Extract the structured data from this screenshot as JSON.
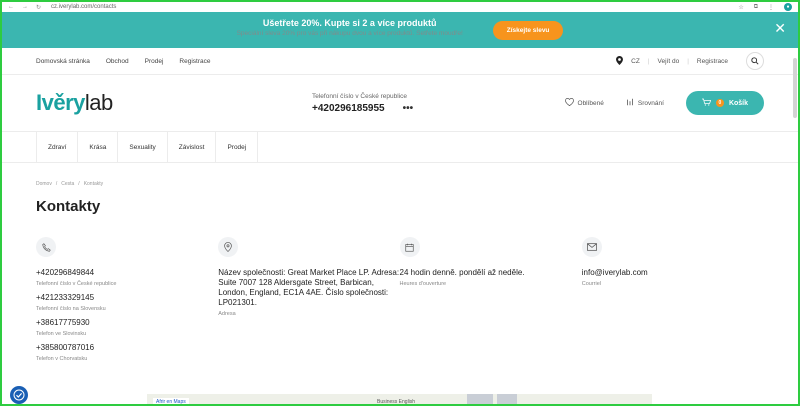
{
  "browser": {
    "url": "cz.iverylab.com/contacts"
  },
  "promo": {
    "title": "Ušetřete 20%. Kupte si 2 a více produktů",
    "subtitle": "Speciální sleva 20% pro vás při nákupu dvou a více produktů. Setřete moudře!",
    "button": "Získejte slevu"
  },
  "topbar": {
    "links": [
      "Domovská stránka",
      "Obchod",
      "Prodej",
      "Registrace"
    ],
    "country": "CZ",
    "login": "Vejít do",
    "register": "Registrace"
  },
  "header": {
    "logo_main": "Ivěry",
    "logo_suffix": "lab",
    "phone_label": "Telefonní číslo v České republice",
    "phone": "+420296185955",
    "more": "•••",
    "favorites": "Oblíbené",
    "compare": "Srovnání",
    "cart": "Košík",
    "cart_count": "0"
  },
  "categories": [
    "Zdraví",
    "Krása",
    "Sexuality",
    "Závislost",
    "Prodej"
  ],
  "breadcrumb": [
    "Domov",
    "Cesta",
    "Kontakty"
  ],
  "page_title": "Kontakty",
  "contacts": {
    "phones": [
      {
        "number": "+420296849844",
        "label": "Telefonní číslo v České republice"
      },
      {
        "number": "+421233329145",
        "label": "Telefonní číslo na Slovensku"
      },
      {
        "number": "+38617775930",
        "label": "Telefon ve Slovinsku"
      },
      {
        "number": "+385800787016",
        "label": "Telefon v Chorvatsku"
      }
    ],
    "address": {
      "value": "Název společnosti: Great Market Place LP. Adresa: Suite 7007 128 Aldersgate Street, Barbican, London, England, EC1A 4AE. Číslo společnosti: LP021301.",
      "label": "Adresa"
    },
    "hours": {
      "value": "24 hodin denně. pondělí až neděle.",
      "label": "Heures d'ouverture"
    },
    "email": {
      "value": "info@iverylab.com",
      "label": "Courriel"
    }
  },
  "map": {
    "link": "Afrir en Maps",
    "label": "Business English"
  },
  "colors": {
    "brand": "#3bb6b0",
    "accent": "#f7941d"
  }
}
